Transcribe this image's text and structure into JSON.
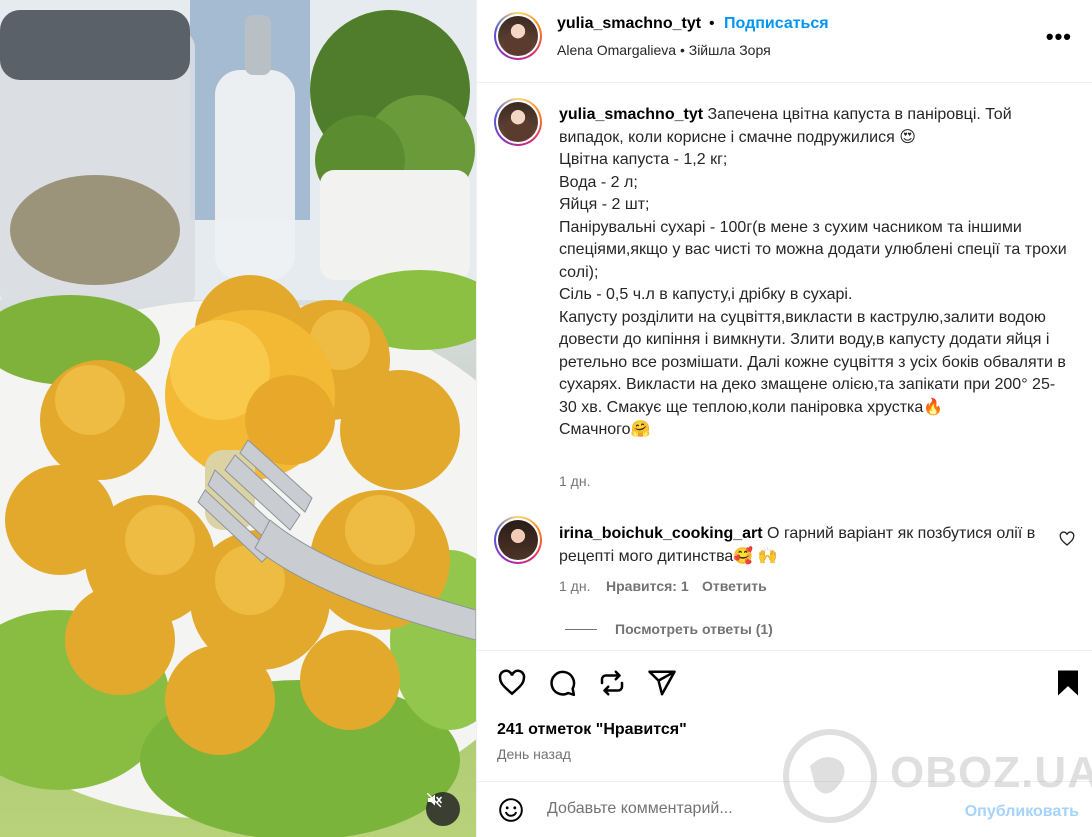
{
  "post": {
    "username": "yulia_smachno_tyt",
    "separator": "•",
    "follow_label": "Подписаться",
    "subtitle": "Alena Omargalieva • Зійшла Зоря",
    "more_label": "•••"
  },
  "caption": {
    "username": "yulia_smachno_tyt",
    "text": " Запечена цвітна капуста в паніровці. Той випадок, коли корисне і смачне подружилися 😍\nЦвітна капуста - 1,2 кг;\nВода - 2 л;\nЯйця - 2 шт;\nПанірувальні сухарі - 100г(в мене з сухим часником та іншими спеціями,якщо у вас чисті то можна додати улюблені спеції та трохи солі);\nСіль - 0,5 ч.л в капусту,і дрібку в сухарі.\nКапусту розділити на суцвіття,викласти в каструлю,залити водою довести до кипіння і вимкнути. Злити воду,в капусту додати яйця і ретельно все розмішати. Далі кожне суцвіття з усіх боків обваляти в сухарях. Викласти на деко змащене олією,та запікати при 200° 25-30 хв. Смакує ще теплою,коли паніровка хрустка🔥\nСмачного🤗",
    "time": "1 дн."
  },
  "comment": {
    "username": "irina_boichuk_cooking_art",
    "text": " О гарний варіант як позбутися олії в рецепті мого дитинства🥰 🙌",
    "time": "1 дн.",
    "likes": "Нравится: 1",
    "reply_label": "Ответить",
    "view_replies": "Посмотреть ответы (1)"
  },
  "actions": {
    "likes_text": "241 отметок \"Нравится\"",
    "date_text": "День назад"
  },
  "composer": {
    "placeholder": "Добавьте комментарий...",
    "publish_label": "Опубликовать"
  },
  "watermark": {
    "text": "OBOZ.UA"
  },
  "icons": {
    "like": "heart-icon",
    "comment": "comment-icon",
    "repost": "repost-icon",
    "share": "share-icon",
    "save": "bookmark-icon",
    "emoji": "emoji-icon",
    "mute": "speaker-muted-icon"
  },
  "colors": {
    "link_blue": "#0095f6",
    "publish_disabled": "#a5d4fb",
    "secondary_text": "#737373"
  }
}
